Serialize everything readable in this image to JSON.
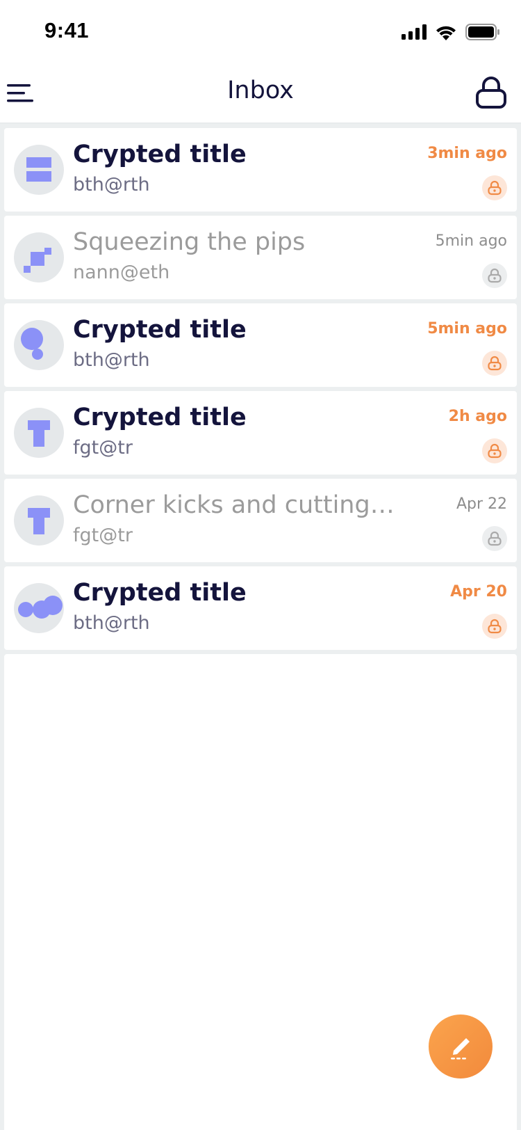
{
  "status_bar": {
    "time": "9:41",
    "icons": [
      "signal-icon",
      "wifi-icon",
      "battery-icon"
    ]
  },
  "header": {
    "title": "Inbox",
    "menu_icon": "hamburger-menu-icon",
    "lock_icon": "lock-icon"
  },
  "colors": {
    "accent": "#f08a45",
    "title_dark": "#14143c",
    "avatar_shape": "#8b91f7",
    "avatar_bg": "#e5e8ea",
    "muted": "#9b9b9b"
  },
  "messages": [
    {
      "title": "Crypted title",
      "sender": "bth@rth",
      "time": "3min ago",
      "unread": true,
      "avatar": "avatar-bars"
    },
    {
      "title": "Squeezing the pips",
      "sender": "nann@eth",
      "time": "5min ago",
      "unread": false,
      "avatar": "avatar-squares"
    },
    {
      "title": "Crypted title",
      "sender": "bth@rth",
      "time": "5min ago",
      "unread": true,
      "avatar": "avatar-circles"
    },
    {
      "title": "Crypted title",
      "sender": "fgt@tr",
      "time": "2h ago",
      "unread": true,
      "avatar": "avatar-t"
    },
    {
      "title": "Corner kicks and cutting corners",
      "sender": "fgt@tr",
      "time": "Apr 22",
      "unread": false,
      "avatar": "avatar-t"
    },
    {
      "title": "Crypted title",
      "sender": "bth@rth",
      "time": "Apr 20",
      "unread": true,
      "avatar": "avatar-dots"
    }
  ],
  "fab": {
    "icon": "compose-pencil-icon"
  }
}
